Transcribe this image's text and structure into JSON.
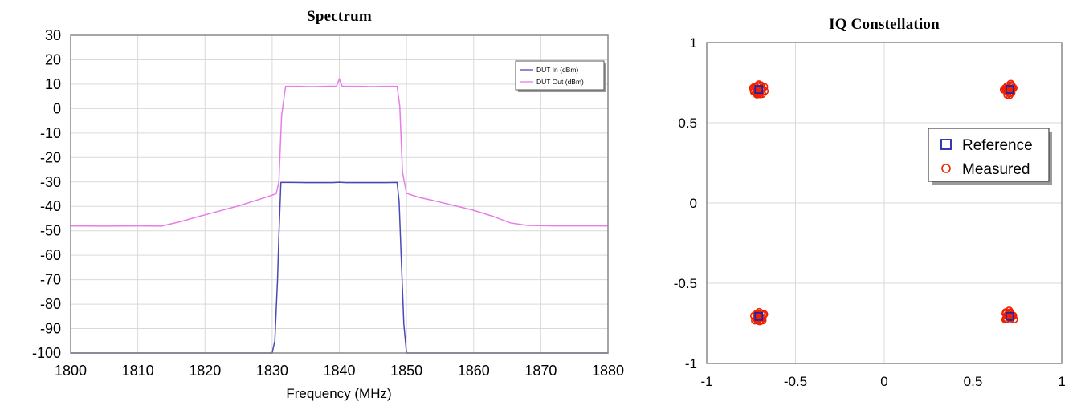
{
  "figure": {
    "background_color": "#ffffff",
    "panels": [
      "spectrum",
      "iq_constellation"
    ]
  },
  "spectrum": {
    "title": "Spectrum",
    "legend": {
      "entries": [
        {
          "label": "DUT In (dBm)",
          "color": "#4a4ab4",
          "marker": "line"
        },
        {
          "label": "DUT Out (dBm)",
          "color": "#e87ce8",
          "marker": "line"
        }
      ]
    }
  },
  "iq": {
    "title": "IQ Constellation",
    "legend": {
      "entries": [
        {
          "label": "Reference",
          "color": "#2222aa",
          "marker": "square"
        },
        {
          "label": "Measured",
          "color": "#ee2200",
          "marker": "circle"
        }
      ]
    }
  },
  "chart_data": [
    {
      "type": "line",
      "id": "spectrum",
      "title": "Spectrum",
      "xlabel": "Frequency (MHz)",
      "ylabel": "",
      "xlim": [
        1800,
        1880
      ],
      "ylim": [
        -100,
        30
      ],
      "xticks": [
        1800,
        1810,
        1820,
        1830,
        1840,
        1850,
        1860,
        1870,
        1880
      ],
      "yticks": [
        30,
        20,
        10,
        0,
        -10,
        -20,
        -30,
        -40,
        -50,
        -60,
        -70,
        -80,
        -90,
        -100
      ],
      "grid": true,
      "legend_position": "top-right",
      "series": [
        {
          "name": "DUT In (dBm)",
          "color": "#4a4ab4",
          "x": [
            1800,
            1829.6,
            1830.0,
            1830.4,
            1830.8,
            1831.0,
            1831.3,
            1833,
            1836,
            1839,
            1840,
            1841,
            1844,
            1847,
            1848.6,
            1848.9,
            1849.2,
            1849.6,
            1850.0,
            1850.4,
            1880
          ],
          "y": [
            -100,
            -100,
            -100,
            -95,
            -70,
            -52,
            -30.2,
            -30.2,
            -30.3,
            -30.3,
            -30.1,
            -30.3,
            -30.3,
            -30.3,
            -30.2,
            -38,
            -60,
            -88,
            -100,
            -100,
            -100
          ]
        },
        {
          "name": "DUT Out (dBm)",
          "color": "#e87ce8",
          "x": [
            1800,
            1805,
            1810,
            1813.5,
            1816,
            1819,
            1822,
            1825,
            1828,
            1829.8,
            1830.6,
            1831.0,
            1831.4,
            1832,
            1834,
            1836,
            1838,
            1839.6,
            1840.0,
            1840.4,
            1841,
            1843,
            1845,
            1847,
            1848.6,
            1849.0,
            1849.4,
            1850.0,
            1850.6,
            1852,
            1854,
            1857,
            1860,
            1863,
            1865.5,
            1868,
            1872,
            1876,
            1880
          ],
          "y": [
            -48,
            -48.1,
            -48,
            -48.1,
            -46.5,
            -44.2,
            -42.0,
            -39.8,
            -37.2,
            -35.6,
            -34.8,
            -30,
            -3,
            9.1,
            9.1,
            9.0,
            9.1,
            9.2,
            12.2,
            9.2,
            9.1,
            9.1,
            9.0,
            9.1,
            9.1,
            1,
            -26,
            -34.6,
            -35.2,
            -36.4,
            -37.6,
            -39.6,
            -41.6,
            -44.2,
            -46.8,
            -47.8,
            -48.0,
            -48.0,
            -48.0
          ]
        }
      ]
    },
    {
      "type": "scatter",
      "id": "iq_constellation",
      "title": "IQ Constellation",
      "xlabel": "",
      "ylabel": "",
      "xlim": [
        -1,
        1
      ],
      "ylim": [
        -1,
        1
      ],
      "xticks": [
        -1,
        -0.5,
        0,
        0.5,
        1
      ],
      "yticks": [
        -1,
        -0.5,
        0,
        0.5,
        1
      ],
      "grid": true,
      "legend_position": "center-right",
      "series": [
        {
          "name": "Reference",
          "color": "#2222aa",
          "marker": "square",
          "points": [
            [
              -0.707,
              0.707
            ],
            [
              0.707,
              0.707
            ],
            [
              -0.707,
              -0.707
            ],
            [
              0.707,
              -0.707
            ]
          ]
        },
        {
          "name": "Measured",
          "color": "#ee2200",
          "marker": "circle",
          "cluster_centers": [
            [
              -0.707,
              0.707
            ],
            [
              0.707,
              0.707
            ],
            [
              -0.707,
              -0.707
            ],
            [
              0.707,
              -0.707
            ]
          ],
          "cluster_spread": 0.035,
          "points_per_cluster": 24
        }
      ]
    }
  ]
}
